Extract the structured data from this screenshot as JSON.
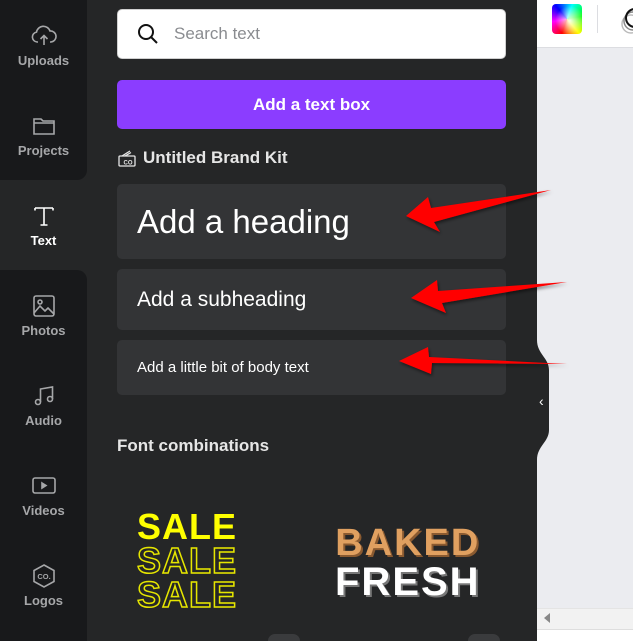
{
  "sidebar": {
    "items": [
      {
        "label": "Uploads",
        "icon": "cloud-upload-icon"
      },
      {
        "label": "Projects",
        "icon": "folder-icon"
      },
      {
        "label": "Text",
        "icon": "text-icon",
        "active": true
      },
      {
        "label": "Photos",
        "icon": "image-icon"
      },
      {
        "label": "Audio",
        "icon": "music-note-icon"
      },
      {
        "label": "Videos",
        "icon": "video-icon"
      },
      {
        "label": "Logos",
        "icon": "logo-hexagon-icon"
      }
    ]
  },
  "panel": {
    "search": {
      "placeholder": "Search text",
      "value": ""
    },
    "add_text_box": "Add a text box",
    "brand_kit": "Untitled Brand Kit",
    "text_styles": {
      "heading": "Add a heading",
      "subheading": "Add a subheading",
      "body": "Add a little bit of body text"
    },
    "font_combinations": {
      "title": "Font combinations",
      "items": [
        {
          "lines": [
            "SALE",
            "SALE",
            "SALE"
          ],
          "color": "#ffff00"
        },
        {
          "lines": [
            "BAKED",
            "FRESH"
          ],
          "colors": [
            "#e0a060",
            "#ffffff"
          ]
        }
      ]
    }
  },
  "colors": {
    "accent": "#8b3dff",
    "annotation_arrow": "#ff0000"
  }
}
